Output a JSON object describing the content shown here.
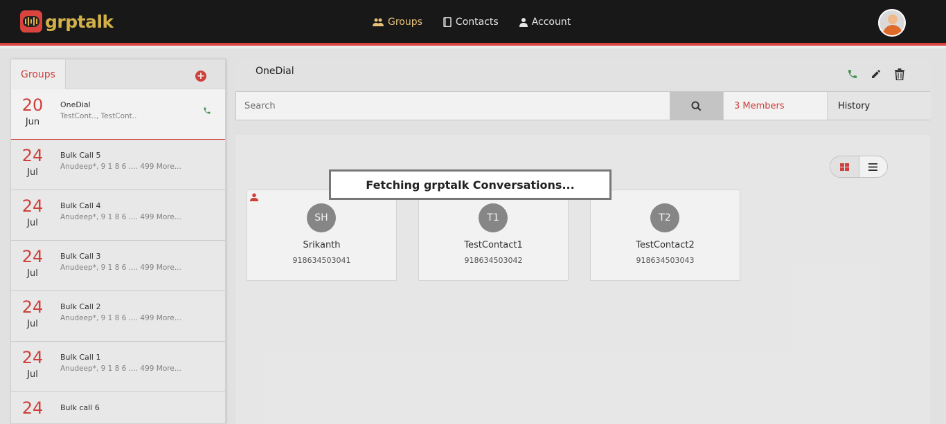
{
  "app": {
    "logo_text": "grptalk",
    "brand_color": "#d9443f"
  },
  "nav": [
    {
      "label": "Groups",
      "icon": "users-icon",
      "active": true
    },
    {
      "label": "Contacts",
      "icon": "address-book-icon",
      "active": false
    },
    {
      "label": "Account",
      "icon": "user-icon",
      "active": false
    }
  ],
  "sidebar": {
    "tab_label": "Groups",
    "add_icon": "plus-circle-icon",
    "items": [
      {
        "day": "20",
        "month": "Jun",
        "name": "OneDial",
        "sub": "TestCont.., TestCont..",
        "selected": true,
        "call_icon": "phone-icon"
      },
      {
        "day": "24",
        "month": "Jul",
        "name": "Bulk Call 5",
        "sub": "Anudeep*, 9 1 8 6 .... 499 More..."
      },
      {
        "day": "24",
        "month": "Jul",
        "name": "Bulk Call 4",
        "sub": "Anudeep*, 9 1 8 6 .... 499 More..."
      },
      {
        "day": "24",
        "month": "Jul",
        "name": "Bulk Call 3",
        "sub": "Anudeep*, 9 1 8 6 .... 499 More..."
      },
      {
        "day": "24",
        "month": "Jul",
        "name": "Bulk Call 2",
        "sub": "Anudeep*, 9 1 8 6 .... 499 More..."
      },
      {
        "day": "24",
        "month": "Jul",
        "name": "Bulk Call 1",
        "sub": "Anudeep*, 9 1 8 6 .... 499 More..."
      },
      {
        "day": "24",
        "month": "",
        "name": "Bulk call 6",
        "sub": ""
      }
    ]
  },
  "group": {
    "title": "OneDial",
    "actions": [
      "phone-icon",
      "pencil-icon",
      "trash-icon"
    ],
    "search_placeholder": "Search",
    "members_label": "3 Members",
    "history_label": "History"
  },
  "members": [
    {
      "initials": "SH",
      "name": "Srikanth",
      "phone": "918634503041",
      "admin": true
    },
    {
      "initials": "T1",
      "name": "TestContact1",
      "phone": "918634503042",
      "admin": false
    },
    {
      "initials": "T2",
      "name": "TestContact2",
      "phone": "918634503043",
      "admin": false
    }
  ],
  "loading": {
    "message": "Fetching grptalk Conversations..."
  }
}
